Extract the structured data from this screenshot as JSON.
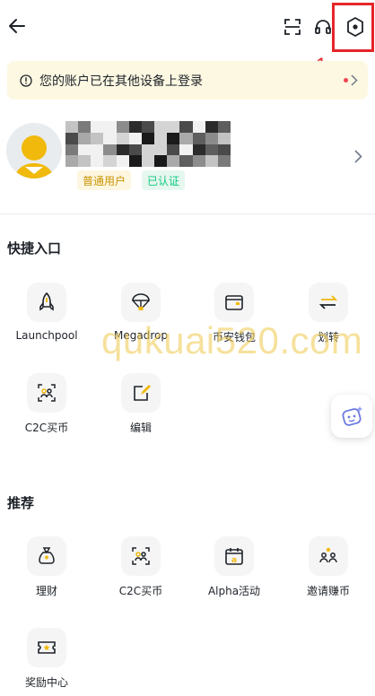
{
  "header": {
    "back_icon": "arrow-left-icon",
    "scan_icon": "scan-icon",
    "support_icon": "headset-icon",
    "settings_icon": "hexagon-settings-icon"
  },
  "annotation": {
    "step_number": "1",
    "color": "#e5252a"
  },
  "notice": {
    "text": "您的账户已在其他设备上登录"
  },
  "profile": {
    "badge_normal": "普通用户",
    "badge_verified": "已认证"
  },
  "shortcuts": {
    "title": "快捷入口",
    "items": [
      {
        "label": "Launchpool",
        "icon": "rocket-icon"
      },
      {
        "label": "Megadrop",
        "icon": "parachute-icon"
      },
      {
        "label": "币安钱包",
        "icon": "wallet-icon"
      },
      {
        "label": "划转",
        "icon": "transfer-icon"
      },
      {
        "label": "C2C买币",
        "icon": "c2c-icon"
      },
      {
        "label": "编辑",
        "icon": "edit-icon"
      }
    ]
  },
  "recommend": {
    "title": "推荐",
    "items": [
      {
        "label": "理财",
        "icon": "money-bag-icon"
      },
      {
        "label": "C2C买币",
        "icon": "c2c-icon"
      },
      {
        "label": "Alpha活动",
        "icon": "alpha-calendar-icon"
      },
      {
        "label": "邀请赚币",
        "icon": "invite-icon"
      },
      {
        "label": "奖励中心",
        "icon": "ticket-star-icon"
      }
    ]
  },
  "watermark": "qukuai520.com",
  "colors": {
    "brand": "#f0b90b",
    "text": "#1e2329",
    "verified": "#0ecb81"
  }
}
